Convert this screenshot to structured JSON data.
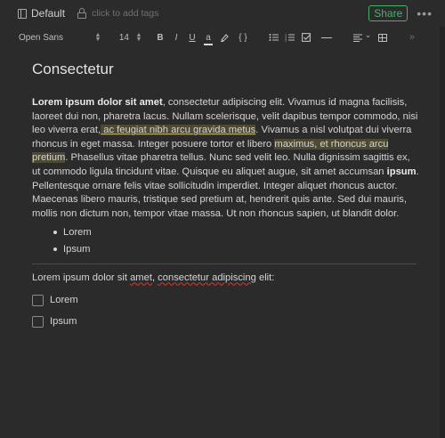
{
  "header": {
    "notebook_label": "Default",
    "tags_placeholder": "click to add tags",
    "share_label": "Share",
    "more_label": "•••"
  },
  "toolbar": {
    "font_family": "Open Sans",
    "font_size": "14",
    "bold": "B",
    "italic": "I",
    "underline": "U",
    "text_color": "a",
    "code_block": "{ }",
    "align_chevron": "⌄",
    "overflow": "»"
  },
  "note": {
    "title": "Consectetur",
    "paragraph": [
      {
        "text": "Lorem ipsum dolor sit amet",
        "style": "bold"
      },
      {
        "text": ", consectetur adipiscing elit. Vivamus id magna facilisis, laoreet dui non, pharetra lacus. Nullam scelerisque, velit dapibus tempor commodo, nisi leo viverra erat,",
        "style": "plain"
      },
      {
        "text": " ac feugiat nibh arcu gravida metus",
        "style": "highlight-underline"
      },
      {
        "text": ". Vivamus a nisl volutpat dui viverra rhoncus in eget massa. Integer posuere tortor et libero ",
        "style": "plain"
      },
      {
        "text": "maximus, et rhoncus arcu pretium",
        "style": "highlight"
      },
      {
        "text": ". Phasellus vitae pharetra tellus. Nunc sed velit leo. Nulla dignissim sagittis ex, ut commodo ligula tincidunt vitae. Quisque eu aliquet augue, sit amet accumsan ",
        "style": "plain"
      },
      {
        "text": "ipsum",
        "style": "bold"
      },
      {
        "text": ". Pellentesque ornare felis vitae sollicitudin imperdiet. Integer aliquet rhoncus auctor. Maecenas libero mauris, tristique sed pretium at, hendrerit quis ante. Sed dui mauris, mollis non dictum non, tempor vitae massa. Ut non rhoncus sapien, ut blandit dolor.",
        "style": "plain"
      }
    ],
    "bullets": [
      "Lorem",
      "Ipsum"
    ],
    "second_paragraph": [
      {
        "text": "Lorem ipsum dolor sit ",
        "style": "plain"
      },
      {
        "text": "amet",
        "style": "spell"
      },
      {
        "text": ", ",
        "style": "plain"
      },
      {
        "text": "consectetur adipiscing",
        "style": "spell"
      },
      {
        "text": " elit:",
        "style": "plain"
      }
    ],
    "checklist": [
      {
        "label": "Lorem",
        "checked": false
      },
      {
        "label": "Ipsum",
        "checked": false
      }
    ]
  },
  "colors": {
    "background": "#2b2b2b",
    "share_green": "#43b36a",
    "highlight": "#6e6438"
  }
}
